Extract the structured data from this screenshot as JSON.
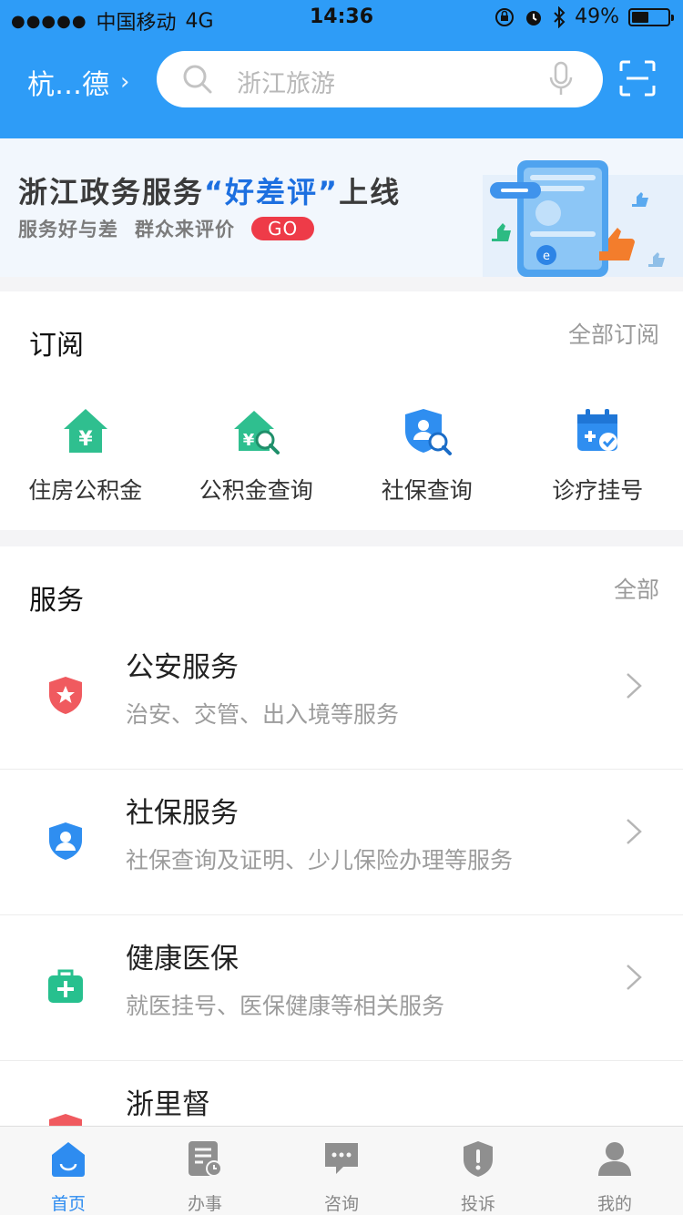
{
  "status_bar": {
    "carrier": "中国移动",
    "network": "4G",
    "time": "14:36",
    "battery": "49%",
    "icons": [
      "signal-dots-icon",
      "orientation-lock-icon",
      "alarm-icon",
      "bluetooth-icon",
      "battery-icon"
    ]
  },
  "header": {
    "city": "杭…德",
    "search_placeholder": "浙江旅游",
    "icons": [
      "search-icon",
      "microphone-icon",
      "scan-icon"
    ],
    "brand_color": "#2e9cf7"
  },
  "banner": {
    "title_pre": "浙江政务服务",
    "title_highlight": "“好差评”",
    "title_post": "上线",
    "subtitle_a": "服务好与差",
    "subtitle_b": "群众来评价",
    "go_label": "GO"
  },
  "subscriptions": {
    "title": "订阅",
    "more_label": "全部订阅",
    "items": [
      {
        "label": "住房公积金",
        "icon": "house-yuan-icon"
      },
      {
        "label": "公积金查询",
        "icon": "house-search-icon"
      },
      {
        "label": "社保查询",
        "icon": "shield-search-icon"
      },
      {
        "label": "诊疗挂号",
        "icon": "calendar-check-icon"
      }
    ]
  },
  "services": {
    "title": "服务",
    "more_label": "全部",
    "items": [
      {
        "title": "公安服务",
        "desc": "治安、交管、出入境等服务",
        "icon": "police-badge-icon",
        "color": "#f05a5f"
      },
      {
        "title": "社保服务",
        "desc": "社保查询及证明、少儿保险办理等服务",
        "icon": "user-shield-icon",
        "color": "#2f8ef0"
      },
      {
        "title": "健康医保",
        "desc": "就医挂号、医保健康等相关服务",
        "icon": "medical-kit-icon",
        "color": "#27c08e"
      },
      {
        "title": "浙里督",
        "desc": "",
        "icon": "supervision-icon",
        "color": "#f05a5f"
      }
    ]
  },
  "tabbar": {
    "tabs": [
      {
        "label": "首页",
        "icon": "home-icon",
        "active": true
      },
      {
        "label": "办事",
        "icon": "task-icon",
        "active": false
      },
      {
        "label": "咨询",
        "icon": "chat-icon",
        "active": false
      },
      {
        "label": "投诉",
        "icon": "complaint-icon",
        "active": false
      },
      {
        "label": "我的",
        "icon": "profile-icon",
        "active": false
      }
    ],
    "active_color": "#2e8cf0"
  }
}
